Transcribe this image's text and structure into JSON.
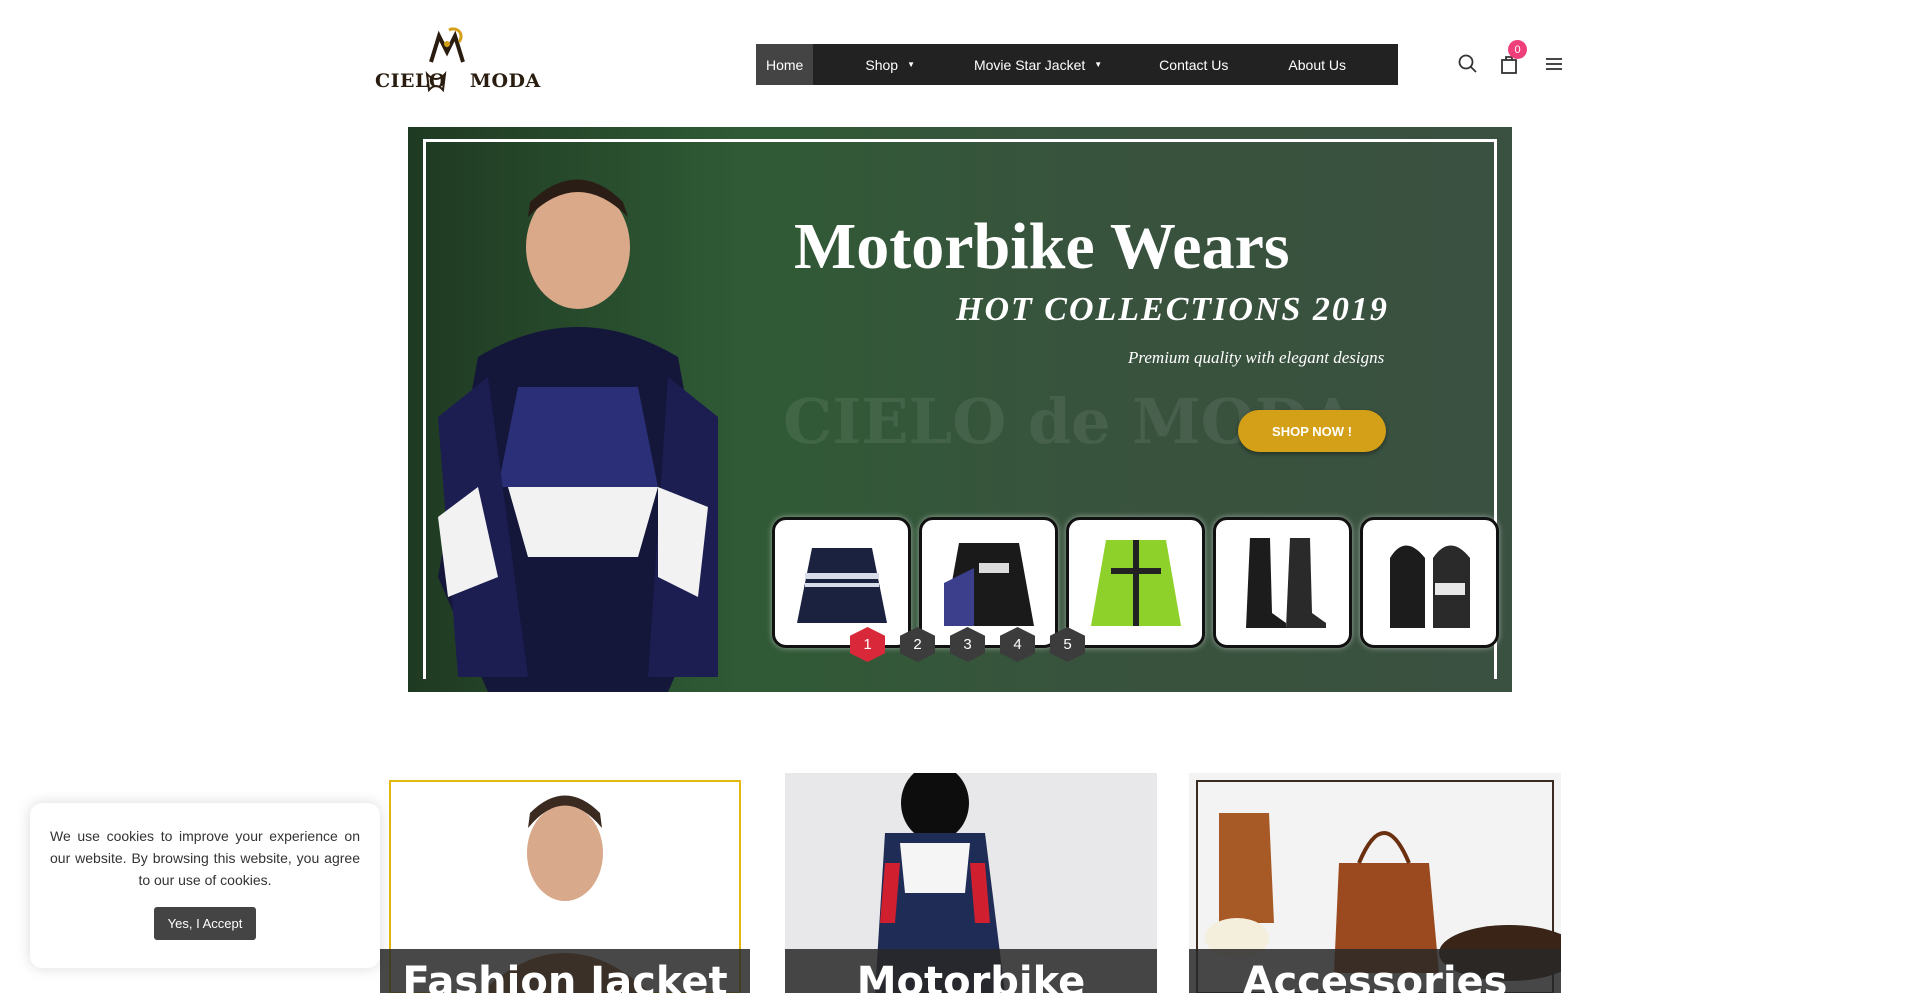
{
  "brand": {
    "logo_text_left": "CIELO",
    "logo_text_right": "MODA",
    "watermark": "CIELO de MODA"
  },
  "nav": {
    "items": [
      {
        "label": "Home",
        "active": true,
        "dropdown": false
      },
      {
        "label": "Shop",
        "active": false,
        "dropdown": true
      },
      {
        "label": "Movie Star Jacket",
        "active": false,
        "dropdown": true
      },
      {
        "label": "Contact Us",
        "active": false,
        "dropdown": false
      },
      {
        "label": "About Us",
        "active": false,
        "dropdown": false
      }
    ],
    "caret": "▼"
  },
  "header_icons": {
    "search": "search-icon",
    "cart": "shopping-bag-icon",
    "menu": "hamburger-menu-icon",
    "cart_count": "0"
  },
  "hero": {
    "title": "Motorbike Wears",
    "subtitle": "HOT COLLECTIONS 2019",
    "tagline": "Premium quality with elegant designs",
    "cta": "SHOP NOW !",
    "thumbnails": [
      "blue-striped-jacket",
      "soul-heaven-jacket",
      "green-textile-jacket",
      "black-boots",
      "black-white-gloves"
    ],
    "slides": [
      "1",
      "2",
      "3",
      "4",
      "5"
    ],
    "active_slide": "1"
  },
  "categories": [
    {
      "label": "Fashion Jacket"
    },
    {
      "label": "Motorbike"
    },
    {
      "label": "Accessories"
    }
  ],
  "cookie": {
    "text": "We use cookies to improve your experience on our website. By browsing this website, you agree to our use of cookies.",
    "button": "Yes, I Accept"
  },
  "colors": {
    "nav_bg": "#222222",
    "accent_gold": "#d4a017",
    "active_dot": "#d9283a",
    "cart_badge": "#ef3f7a"
  }
}
